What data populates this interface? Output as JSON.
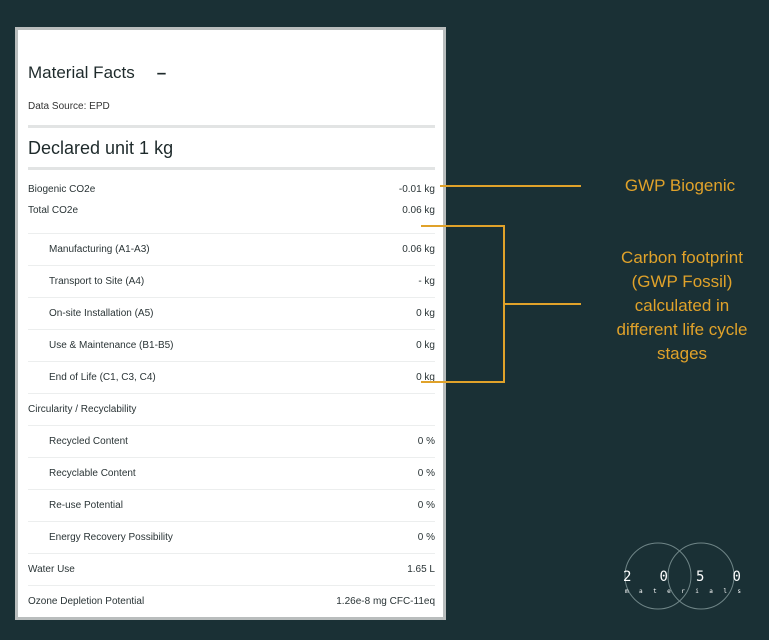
{
  "colors": {
    "background": "#1a3035",
    "accent": "#e0a22a"
  },
  "panel": {
    "title": "Material Facts",
    "collapse_label": "–",
    "source": "Data Source: EPD",
    "declared_unit": "Declared unit 1 kg",
    "rows": [
      {
        "label": "Biogenic CO2e",
        "value": "-0.01 kg",
        "indent": false
      },
      {
        "label": "Total CO2e",
        "value": "0.06 kg",
        "indent": false
      },
      {
        "label": "Manufacturing (A1-A3)",
        "value": "0.06 kg",
        "indent": true
      },
      {
        "label": "Transport to Site (A4)",
        "value": "- kg",
        "indent": true
      },
      {
        "label": "On-site Installation (A5)",
        "value": "0 kg",
        "indent": true
      },
      {
        "label": "Use & Maintenance (B1-B5)",
        "value": "0 kg",
        "indent": true
      },
      {
        "label": "End of Life (C1, C3, C4)",
        "value": "0 kg",
        "indent": true
      },
      {
        "label": "Circularity / Recyclability",
        "value": "",
        "indent": false
      },
      {
        "label": "Recycled Content",
        "value": "0 %",
        "indent": true
      },
      {
        "label": "Recyclable Content",
        "value": "0 %",
        "indent": true
      },
      {
        "label": "Re-use Potential",
        "value": "0 %",
        "indent": true
      },
      {
        "label": "Energy Recovery Possibility",
        "value": "0 %",
        "indent": true
      },
      {
        "label": "Water Use",
        "value": "1.65 L",
        "indent": false
      },
      {
        "label": "Ozone Depletion Potential",
        "value": "1.26e-8 mg CFC-11eq",
        "indent": false
      }
    ]
  },
  "annotations": {
    "gwp_biogenic": "GWP Biogenic",
    "carbon_lines": [
      "Carbon footprint",
      "(GWP Fossil)",
      "calculated in",
      "different life cycle",
      "stages"
    ]
  },
  "logo": {
    "digits": [
      "2",
      "0",
      "5",
      "0"
    ],
    "letters": [
      "m",
      "a",
      "t",
      "e",
      "r",
      "i",
      "a",
      "l",
      "s"
    ]
  }
}
